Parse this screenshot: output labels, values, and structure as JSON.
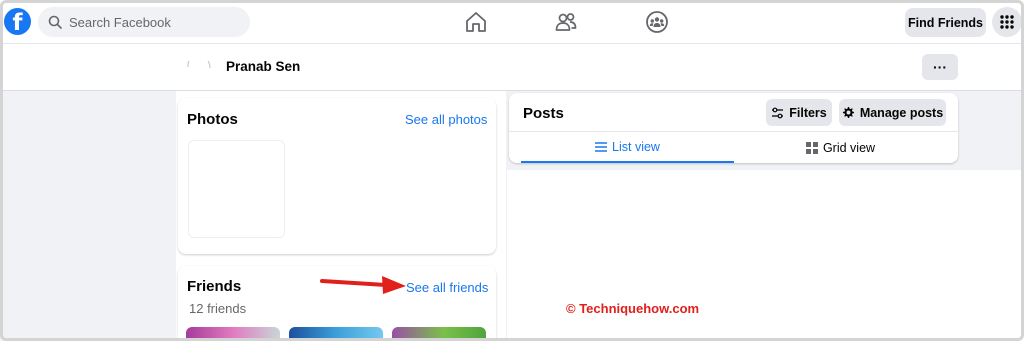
{
  "topnav": {
    "logo_letter": "f",
    "search_placeholder": "Search Facebook",
    "icons": [
      "home-icon",
      "friends-icon",
      "groups-icon"
    ],
    "find_friends_label": "Find Friends",
    "menu_icon": "menu-grid-icon",
    "brand_color": "#1877f2"
  },
  "profile": {
    "name": "Pranab Sen",
    "more_label": "···"
  },
  "photos": {
    "title": "Photos",
    "see_all": "See all photos"
  },
  "friends": {
    "title": "Friends",
    "count": "12 friends",
    "see_all": "See all friends"
  },
  "posts": {
    "title": "Posts",
    "filters_label": "Filters",
    "manage_label": "Manage posts",
    "tabs": [
      {
        "label": "List view",
        "active": true
      },
      {
        "label": "Grid view",
        "active": false
      }
    ]
  },
  "annotation": {
    "watermark": "© Techniquehow.com",
    "arrow_color": "#e0201b"
  }
}
